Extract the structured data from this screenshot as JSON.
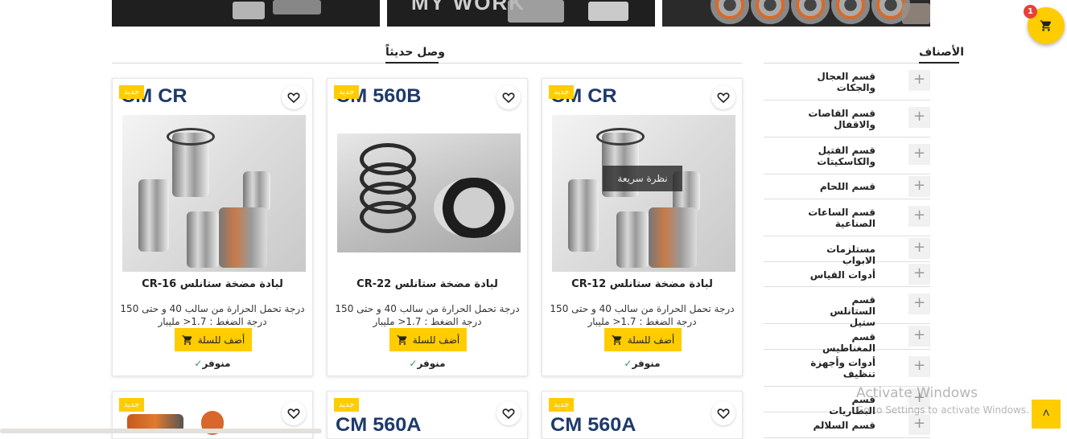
{
  "banners": [
    {
      "name": "banner-left"
    },
    {
      "name": "banner-middle",
      "text": "MY WORK"
    },
    {
      "name": "banner-right"
    }
  ],
  "sections": {
    "new_arrivals": "وصل حديثاً",
    "categories": "الأصناف"
  },
  "categories": [
    {
      "label": "قسم العجال والجكات"
    },
    {
      "label": "قسم القاصات والاقفال"
    },
    {
      "label": "قسم الفتيل والكاسكيتات"
    },
    {
      "label": "قسم اللحام"
    },
    {
      "label": "قسم الساعات الصناعية"
    },
    {
      "label": "مستلزمات الابواب"
    },
    {
      "label": "أدوات القياس"
    },
    {
      "label": "قسم الستانلس ستيل"
    },
    {
      "label": "قسم المغناطيس"
    },
    {
      "label": "أدوات وأجهزة تنظيف"
    },
    {
      "label": "قسم البطاريات"
    },
    {
      "label": "قسم السلالم"
    }
  ],
  "products": [
    {
      "badge": "جديد",
      "brand": "CM CR",
      "title": "لبادة مضخة ستانلس CR-12",
      "description": "درجة تحمل الحرارة من سالب 40 و حتى 150 درجة الضغط : 1.7&lt; مليبار",
      "add_to_cart": "أضف للسلة",
      "stock": "منوفر",
      "quick_view": "نظرة سريعة"
    },
    {
      "badge": "جديد",
      "brand": "CM 560B",
      "title": "لبادة مضخة ستانلس CR-22",
      "description": "درجة تحمل الحرارة من سالب 40 و حتى 150 درجة الضغط : 1.7&lt; مليبار",
      "add_to_cart": "أضف للسلة",
      "stock": "منوفر"
    },
    {
      "badge": "جديد",
      "brand": "CM CR",
      "title": "لبادة مضخة ستانلس CR-16",
      "description": "درجة تحمل الحرارة من سالب 40 و حتى 150 درجة الضغط : 1.7&lt; مليبار",
      "add_to_cart": "أضف للسلة",
      "stock": "منوفر"
    }
  ],
  "products_row2": [
    {
      "badge": "جديد",
      "brand": "CM 560A"
    },
    {
      "badge": "جديد",
      "brand": "CM 560A"
    },
    {
      "badge": "جديد",
      "brand": ""
    }
  ],
  "cart": {
    "count": "1"
  },
  "overlay": {
    "activate_title": "Activate Windows",
    "activate_sub": "Go to Settings to activate Windows."
  },
  "colors": {
    "accent": "#ffcc00",
    "badge_red": "#e8403a",
    "stock_check": "#2c9a4a"
  }
}
